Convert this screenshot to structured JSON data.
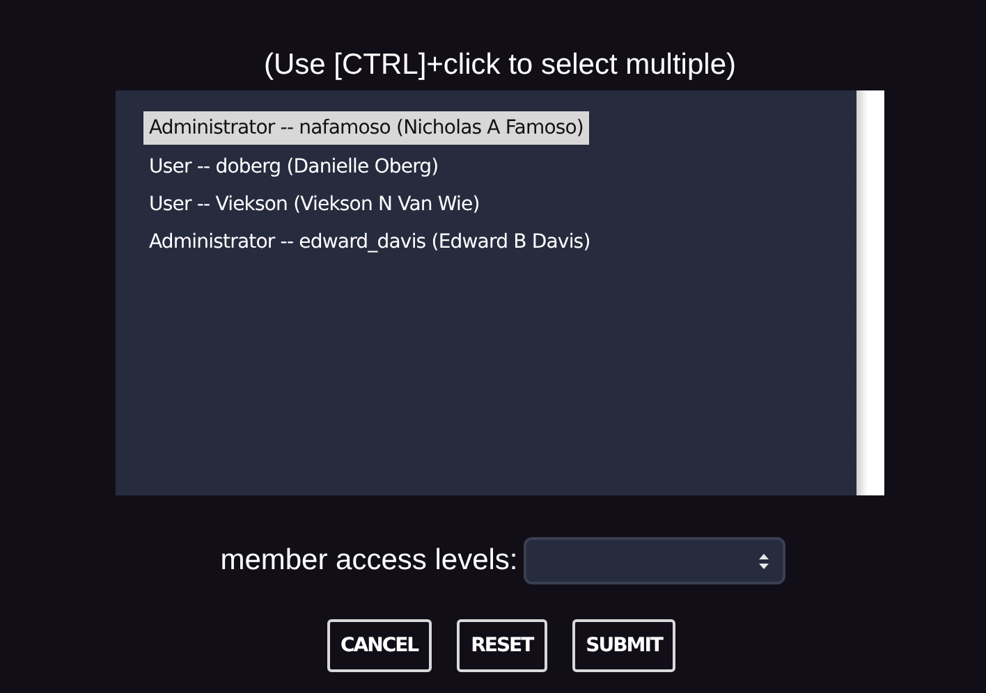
{
  "hint": "(Use [CTRL]+click to select multiple)",
  "members": [
    {
      "label": "Administrator -- nafamoso (Nicholas A Famoso)",
      "selected": true
    },
    {
      "label": "User -- doberg (Danielle Oberg)",
      "selected": false
    },
    {
      "label": "User -- Viekson (Viekson N Van Wie)",
      "selected": false
    },
    {
      "label": "Administrator -- edward_davis (Edward B Davis)",
      "selected": false
    }
  ],
  "access_label": "member access levels:",
  "buttons": [
    "CANCEL",
    "RESET",
    "SUBMIT"
  ]
}
